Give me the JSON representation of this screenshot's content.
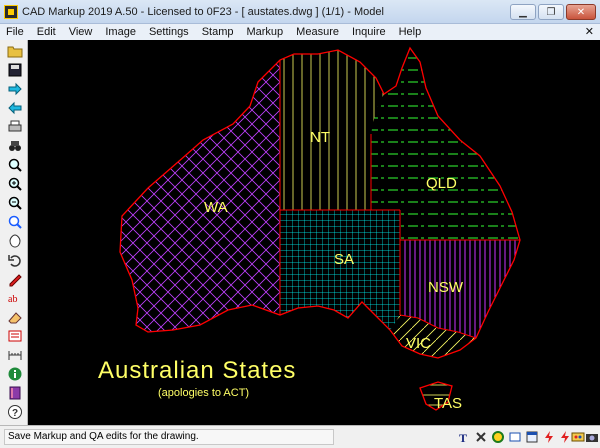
{
  "window": {
    "title": "CAD Markup 2019 A.50 - Licensed to 0F23  -  [ austates.dwg ] (1/1)  -  Model",
    "minimize_glyph": "▁",
    "restore_glyph": "❐",
    "close_glyph": "✕"
  },
  "menu": {
    "items": [
      "File",
      "Edit",
      "View",
      "Image",
      "Settings",
      "Stamp",
      "Markup",
      "Measure",
      "Inquire",
      "Help"
    ],
    "close_glyph": "✕"
  },
  "toolbar": {
    "icons": [
      "open-folder-icon",
      "save-disk-icon",
      "arrow-right-icon",
      "arrow-left-icon",
      "print-icon",
      "binoculars-icon",
      "zoom-icon",
      "zoom-in-icon",
      "zoom-out-icon",
      "zoom-window-icon",
      "pan-icon",
      "undo-icon",
      "pen-icon",
      "text-ab-icon",
      "eraser-icon",
      "stamp-icon",
      "measure-icon",
      "info-icon",
      "book-icon",
      "help-icon"
    ]
  },
  "drawing": {
    "colors": {
      "outline": "#ff0000",
      "wa": "#c040ff",
      "nt": "#ffff66",
      "qld": "#33ff33",
      "sa": "#00ffff",
      "nsw": "#cc33ff",
      "vic": "#ffff66",
      "tas": "#ffff66",
      "caption": "#ffff66"
    },
    "labels": {
      "wa": "WA",
      "nt": "NT",
      "qld": "QLD",
      "sa": "SA",
      "nsw": "NSW",
      "vic": "VIC",
      "tas": "TAS"
    },
    "title": "Australian States",
    "subtitle": "(apologies to ACT)"
  },
  "status": {
    "message": "Save Markup and QA edits for the drawing.",
    "icons": [
      "text-tool-icon",
      "cross-icon",
      "color-fill-icon",
      "layer-icon",
      "window-icon",
      "lightning-icon",
      "lightning-icon-2",
      "palette-icon",
      "camera-icon"
    ]
  }
}
